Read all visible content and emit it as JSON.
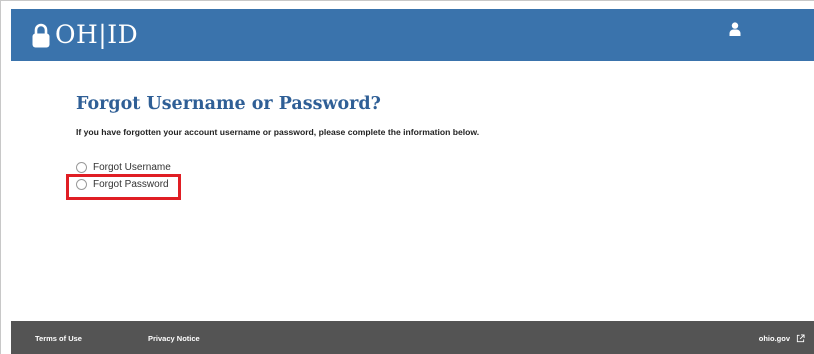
{
  "header": {
    "logo_text": "OH|ID",
    "background_color": "#3a73ac",
    "lock_icon": "lock-icon",
    "user_icon": "user-icon"
  },
  "main": {
    "title": "Forgot Username or Password?",
    "title_color": "#2f5f96",
    "instructions": "If you have forgotten your account username or password, please complete the information below.",
    "options": [
      {
        "label": "Forgot Username",
        "selected": false
      },
      {
        "label": "Forgot Password",
        "selected": false,
        "highlighted": true
      }
    ],
    "highlight_color": "#e01e24"
  },
  "footer": {
    "background_color": "#545454",
    "links": [
      {
        "label": "Terms of Use"
      },
      {
        "label": "Privacy Notice"
      },
      {
        "label": "ohio.gov",
        "icon": "external-link-icon"
      }
    ]
  }
}
